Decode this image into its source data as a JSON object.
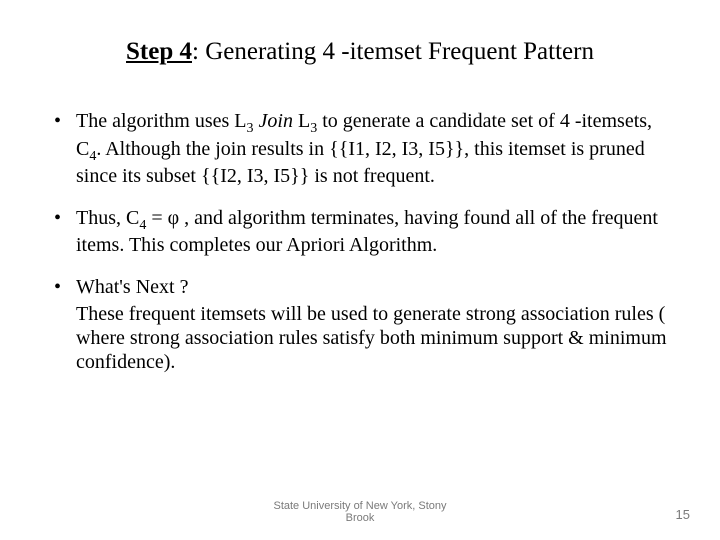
{
  "title": {
    "step_label": "Step 4",
    "rest": ": Generating 4 -itemset Frequent Pattern"
  },
  "bullets": {
    "b1_a": "The algorithm uses L",
    "b1_b": "Join",
    "b1_c": " L",
    "b1_d": " to generate a candidate set of 4 -itemsets, C",
    "b1_e": ". Although the join results in {{I1, I2, I3, I5}}, this itemset is pruned since its subset {{I2, I3, I5}} is not frequent.",
    "b2_a": "Thus, C",
    "b2_b": " = ",
    "b2_phi": "φ",
    "b2_c": " , and algorithm terminates, having found all of the frequent items. This completes our Apriori Algorithm.",
    "b3": "What's Next ?",
    "b3_follow": "These frequent itemsets will be used to generate strong association rules ( where strong association rules satisfy both minimum support & minimum confidence).",
    "sub3": "3",
    "sub4": "4"
  },
  "footer": {
    "org_line1": "State University of New York, Stony",
    "org_line2": "Brook",
    "page": "15"
  }
}
